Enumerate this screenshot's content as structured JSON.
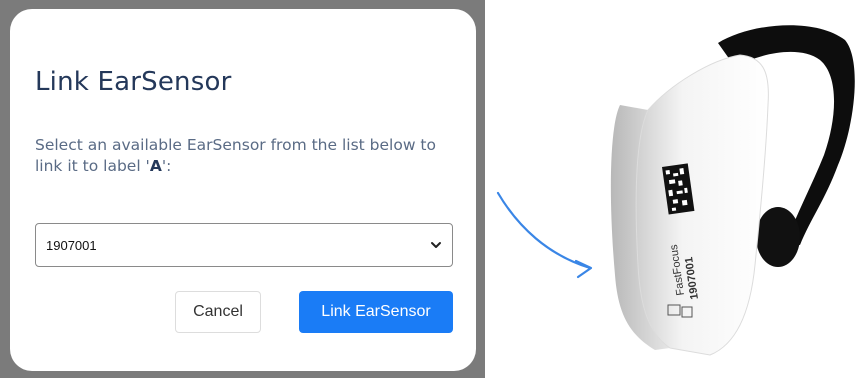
{
  "dialog": {
    "title": "Link EarSensor",
    "description_prefix": "Select an available EarSensor from the list below to link it to label '",
    "label_name": "A",
    "description_suffix": "':",
    "select_value": "1907001",
    "cancel_label": "Cancel",
    "confirm_label": "Link EarSensor"
  },
  "device": {
    "brand": "FastFocus",
    "serial": "1907001"
  },
  "colors": {
    "primary": "#1a7cf6",
    "title": "#24385a",
    "backdrop": "#7b7b7b",
    "arrow": "#3a86e6"
  }
}
